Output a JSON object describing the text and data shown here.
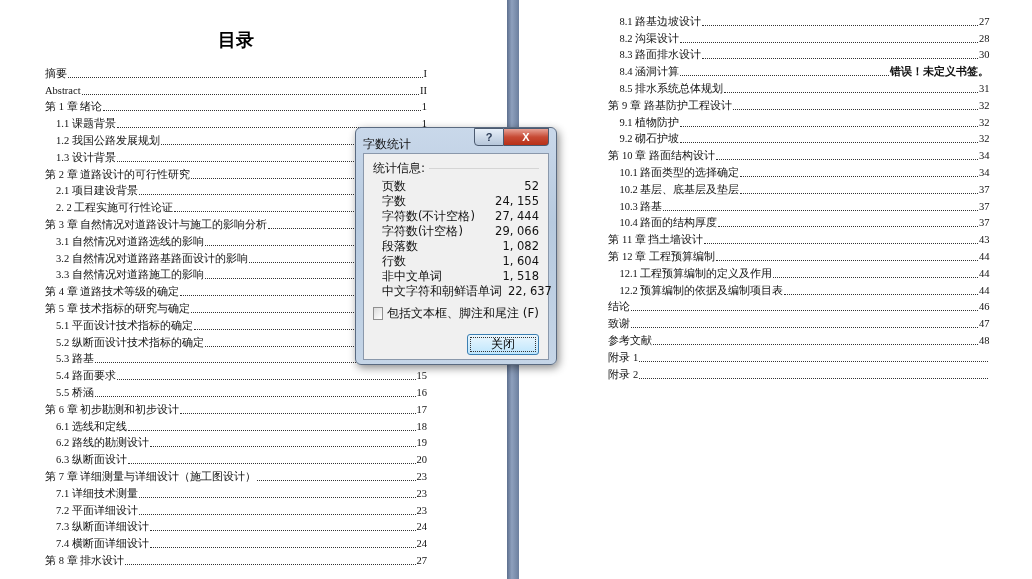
{
  "pages": [
    {
      "title": "目录",
      "entries": [
        {
          "label": "摘要",
          "page": "I"
        },
        {
          "label": "Abstract",
          "page": "II"
        },
        {
          "label": "第 1 章  绪论",
          "page": "1",
          "children": [
            {
              "label": "1.1  课题背景",
              "page": "1"
            },
            {
              "label": "1.2  我国公路发展规划"
            },
            {
              "label": "1.3  设计背景"
            }
          ]
        },
        {
          "label": "第 2 章  道路设计的可行性研究",
          "children": [
            {
              "label": "2.1  项目建设背景"
            },
            {
              "label": "2. 2  工程实施可行性论证"
            }
          ]
        },
        {
          "label": "第 3 章  自然情况对道路设计与施工的影响分析",
          "children": [
            {
              "label": "3.1  自然情况对道路选线的影响"
            },
            {
              "label": "3.2  自然情况对道路路基路面设计的影响"
            },
            {
              "label": "3.3  自然情况对道路施工的影响"
            }
          ]
        },
        {
          "label": "第 4 章  道路技术等级的确定"
        },
        {
          "label": "第 5 章  技术指标的研究与确定",
          "children": [
            {
              "label": "5.1  平面设计技术指标的确定"
            },
            {
              "label": "5.2  纵断面设计技术指标的确定"
            },
            {
              "label": "5.3  路基"
            },
            {
              "label": "5.4  路面要求",
              "page": "15"
            },
            {
              "label": "5.5  桥涵",
              "page": "16"
            }
          ]
        },
        {
          "label": "第 6 章  初步勘测和初步设计",
          "page": "17",
          "children": [
            {
              "label": "6.1  选线和定线",
              "page": "18"
            },
            {
              "label": "6.2  路线的勘测设计",
              "page": "19"
            },
            {
              "label": "6.3  纵断面设计",
              "page": "20"
            }
          ]
        },
        {
          "label": "第 7 章  详细测量与详细设计（施工图设计）",
          "page": "23",
          "children": [
            {
              "label": "7.1  详细技术测量",
              "page": "23"
            },
            {
              "label": "7.2  平面详细设计",
              "page": "23"
            },
            {
              "label": "7.3  纵断面详细设计",
              "page": "24"
            },
            {
              "label": "7.4  横断面详细设计",
              "page": "24"
            }
          ]
        },
        {
          "label": "第 8 章  排水设计",
          "page": "27"
        }
      ]
    },
    {
      "entries": [
        {
          "children": [
            {
              "label": "8.1  路基边坡设计",
              "page": "27"
            },
            {
              "label": "8.2  沟渠设计",
              "page": "28"
            },
            {
              "label": "8.3  路面排水设计",
              "page": "30"
            },
            {
              "label": "8.4  涵洞计算",
              "error": "错误！未定义书签。"
            },
            {
              "label": "8.5  排水系统总体规划",
              "page": "31"
            }
          ]
        },
        {
          "label": "第 9 章  路基防护工程设计",
          "page": "32",
          "children": [
            {
              "label": "9.1  植物防护",
              "page": "32"
            },
            {
              "label": "9.2  砌石护坡",
              "page": "32"
            }
          ]
        },
        {
          "label": "第 10 章  路面结构设计",
          "page": "34",
          "children": [
            {
              "label": "10.1  路面类型的选择确定",
              "page": "34"
            },
            {
              "label": "10.2  基层、底基层及垫层",
              "page": "37"
            },
            {
              "label": "10.3  路基",
              "page": "37"
            },
            {
              "label": "10.4  路面的结构厚度",
              "page": "37"
            }
          ]
        },
        {
          "label": "第 11 章  挡土墙设计",
          "page": "43"
        },
        {
          "label": "第 12 章  工程预算编制",
          "page": "44",
          "children": [
            {
              "label": "12.1  工程预算编制的定义及作用",
              "page": "44"
            },
            {
              "label": "12.2  预算编制的依据及编制项目表",
              "page": "44"
            }
          ]
        },
        {
          "label": "结论",
          "page": "46"
        },
        {
          "label": "致谢",
          "page": "47"
        },
        {
          "label": "参考文献",
          "page": "48"
        },
        {
          "label": "附录 1"
        },
        {
          "label": "附录 2"
        }
      ]
    }
  ],
  "dialog": {
    "title": "字数统计",
    "help": "?",
    "close": "X",
    "group": "统计信息:",
    "stats": [
      {
        "label": "页数",
        "value": "52"
      },
      {
        "label": "字数",
        "value": "24, 155"
      },
      {
        "label": "字符数(不计空格)",
        "value": "27, 444"
      },
      {
        "label": "字符数(计空格)",
        "value": "29, 066"
      },
      {
        "label": "段落数",
        "value": "1, 082"
      },
      {
        "label": "行数",
        "value": "1, 604"
      },
      {
        "label": "非中文单词",
        "value": "1, 518"
      },
      {
        "label": "中文字符和朝鲜语单词",
        "value": "22, 637"
      }
    ],
    "checkbox": {
      "label": "包括文本框、脚注和尾注 (F)",
      "checked": false
    },
    "button": "关闭"
  }
}
